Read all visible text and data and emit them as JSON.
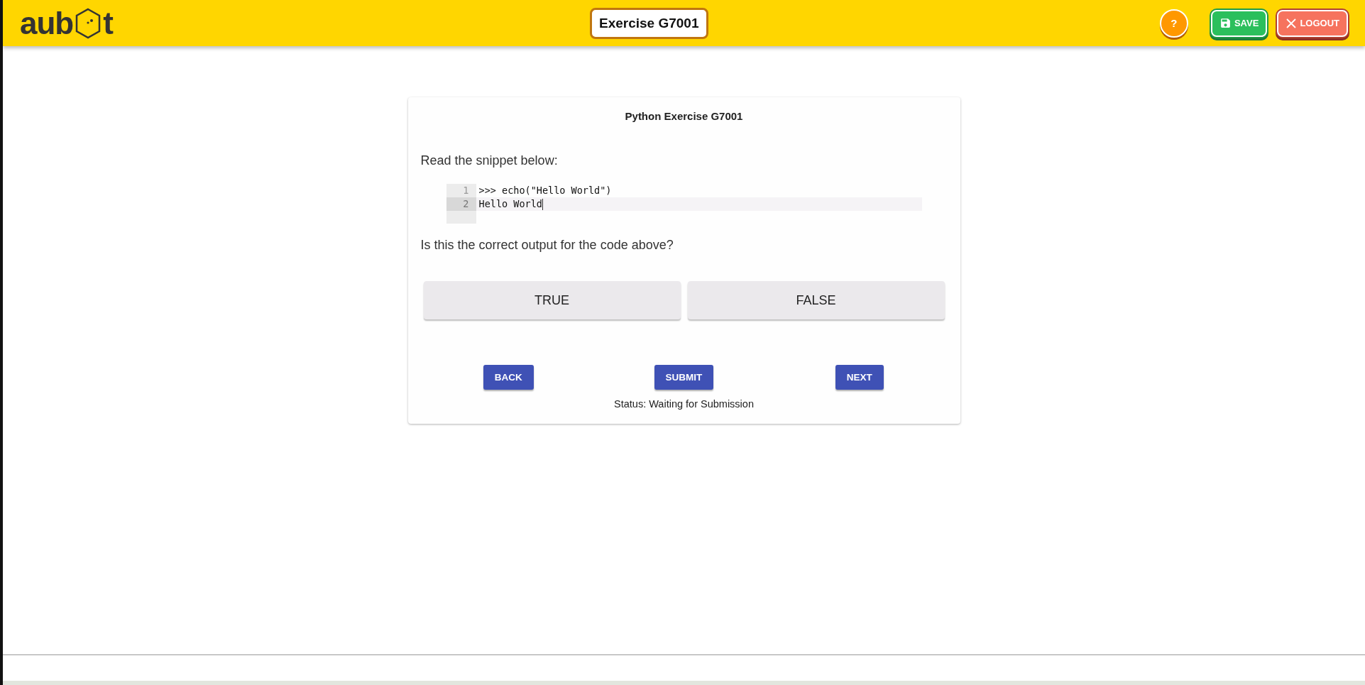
{
  "header": {
    "logo": {
      "before": "aub",
      "after": "t"
    },
    "exercise_title": "Exercise G7001",
    "help": "?",
    "save": "SAVE",
    "logout": "LOGOUT"
  },
  "card": {
    "title": "Python Exercise G7001",
    "prompt": "Read the snippet below:",
    "code": [
      {
        "number": "1",
        "text": ">>> echo(\"Hello World\")",
        "active": false
      },
      {
        "number": "2",
        "text": "Hello World",
        "active": true
      }
    ],
    "question": "Is this the correct output for the code above?",
    "answers": [
      {
        "label": "TRUE",
        "selected": false
      },
      {
        "label": "FALSE",
        "selected": false
      }
    ],
    "nav": [
      "BACK",
      "SUBMIT",
      "NEXT"
    ],
    "status": "Status: Waiting for Submission"
  }
}
